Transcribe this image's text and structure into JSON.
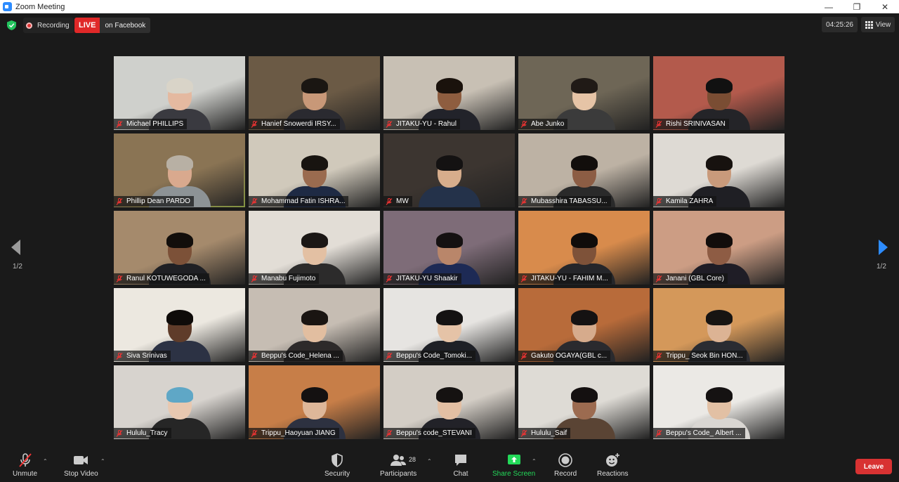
{
  "window": {
    "title": "Zoom Meeting"
  },
  "topbar": {
    "recording_label": "Recording",
    "live_label": "LIVE",
    "live_destination": "on Facebook",
    "timer": "04:25:26",
    "view_label": "View"
  },
  "gallery": {
    "page_indicator": "1/2",
    "tiles": [
      {
        "name": "Michael PHILLIPS",
        "bg": "#cfd0cc",
        "skin": "#e4b9a0",
        "hair": "#d9d4c8",
        "shirt": "#3a3a40"
      },
      {
        "name": "Hanief Snowerdi IRSY...",
        "bg": "#6b5a45",
        "skin": "#c89878",
        "hair": "#1a1612",
        "shirt": "#2a2a30"
      },
      {
        "name": "JITAKU-YU - Rahul",
        "bg": "#c8c0b4",
        "skin": "#8e5d3f",
        "hair": "#1a120c",
        "shirt": "#22232a"
      },
      {
        "name": "Abe Junko",
        "bg": "#6e6656",
        "skin": "#e6c4a6",
        "hair": "#201a16",
        "shirt": "#3b3b3b"
      },
      {
        "name": "Rishi SRINIVASAN",
        "bg": "#b35a4c",
        "skin": "#7a4d33",
        "hair": "#111",
        "shirt": "#242428"
      },
      {
        "name": "Phillip Dean PARDO",
        "bg": "#8a7454",
        "skin": "#d9a98e",
        "hair": "#b8b0a4",
        "shirt": "#8d9396"
      },
      {
        "name": "Mohammad Fatin ISHRA...",
        "bg": "#d0c9bb",
        "skin": "#9a6b4f",
        "hair": "#181410",
        "shirt": "#1e2a44"
      },
      {
        "name": "MW",
        "bg": "#3c3530",
        "skin": "#d7ad8c",
        "hair": "#141212",
        "shirt": "#24324a"
      },
      {
        "name": "Mubasshira TABASSU...",
        "bg": "#bdb2a4",
        "skin": "#8c5d44",
        "hair": "#120e0c",
        "shirt": "#2a2a2a"
      },
      {
        "name": "Kamila ZAHRA",
        "bg": "#dedad4",
        "skin": "#c99a7b",
        "hair": "#17120f",
        "shirt": "#1f1f24"
      },
      {
        "name": "Ranul KOTUWEGODA ...",
        "bg": "#a58a6c",
        "skin": "#7c5138",
        "hair": "#120e0b",
        "shirt": "#1f2024"
      },
      {
        "name": "Manabu Fujimoto",
        "bg": "#e2ddd6",
        "skin": "#e3c0a3",
        "hair": "#1b1715",
        "shirt": "#2c2b2b"
      },
      {
        "name": "JITAKU-YU Shaakir",
        "bg": "#7e6c78",
        "skin": "#b9866a",
        "hair": "#151111",
        "shirt": "#1d2a55"
      },
      {
        "name": "JITAKU-YU - FAHIM M...",
        "bg": "#d88b4c",
        "skin": "#7e5239",
        "hair": "#100c0a",
        "shirt": "#25262a"
      },
      {
        "name": "Janani (GBL Core)",
        "bg": "#cc9d84",
        "skin": "#8e5c44",
        "hair": "#120d0b",
        "shirt": "#1f1d26"
      },
      {
        "name": "Siva Srinivas",
        "bg": "#ece8e0",
        "skin": "#5f3c2a",
        "hair": "#0e0b09",
        "shirt": "#2c3244"
      },
      {
        "name": "Beppu's Code_Helena ...",
        "bg": "#c6bdb3",
        "skin": "#e2bea0",
        "hair": "#1a1512",
        "shirt": "#2d2a2a"
      },
      {
        "name": "Beppu's Code_Tomoki...",
        "bg": "#e6e4e1",
        "skin": "#e5c3a7",
        "hair": "#141212",
        "shirt": "#1e2026"
      },
      {
        "name": "Gakuto OGAYA(GBL c...",
        "bg": "#b86b3a",
        "skin": "#d6ab8c",
        "hair": "#151212",
        "shirt": "#2a2a2e"
      },
      {
        "name": "Trippu_ Seok Bin HON...",
        "bg": "#d4985a",
        "skin": "#dcb394",
        "hair": "#171412",
        "shirt": "#2a2c32"
      },
      {
        "name": "Hululu_Tracy",
        "bg": "#d7d3ce",
        "skin": "#e8c8b0",
        "hair": "#5fa7c6",
        "shirt": "#262626"
      },
      {
        "name": "Trippu_Haoyuan JIANG",
        "bg": "#c77e48",
        "skin": "#deb799",
        "hair": "#141111",
        "shirt": "#2d3140"
      },
      {
        "name": "Beppu's code_STEVANI",
        "bg": "#d3cdc5",
        "skin": "#e3bfa3",
        "hair": "#151211",
        "shirt": "#222228"
      },
      {
        "name": "Hululu_Saif",
        "bg": "#dedbd5",
        "skin": "#9c6b50",
        "hair": "#141010",
        "shirt": "#5a4434"
      },
      {
        "name": "Beppu's Code_ Albert ...",
        "bg": "#ebe9e5",
        "skin": "#e2c0a4",
        "hair": "#151212",
        "shirt": "#d9d6d2"
      }
    ]
  },
  "toolbar": {
    "unmute": "Unmute",
    "stop_video": "Stop Video",
    "security": "Security",
    "participants": "Participants",
    "participant_count": "28",
    "chat": "Chat",
    "share_screen": "Share Screen",
    "record": "Record",
    "reactions": "Reactions",
    "leave": "Leave"
  },
  "colors": {
    "share_green": "#23d959",
    "leave_red": "#d83232",
    "live_red": "#e02828",
    "active_speaker": "#c9e265"
  }
}
